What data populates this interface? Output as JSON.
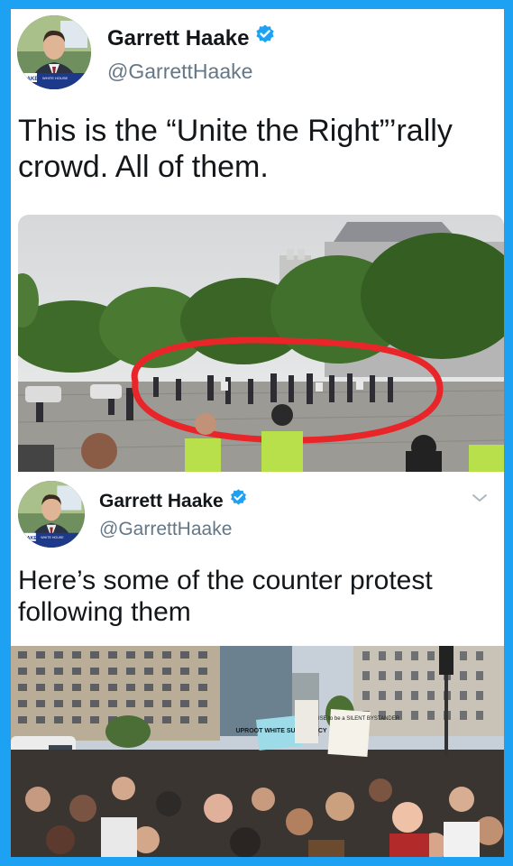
{
  "tweets": [
    {
      "author": {
        "name": "Garrett Haake",
        "handle": "@GarrettHaake",
        "verified": true,
        "avatar_badge": "HAAKE",
        "avatar_badge_sub": "WHITE HOUSE"
      },
      "text": "This is the “Unite the Right”’rally crowd. All of them.",
      "media": {
        "description_icon": "photo-rally-crowd-circled"
      }
    },
    {
      "author": {
        "name": "Garrett Haake",
        "handle": "@GarrettHaake",
        "verified": true,
        "avatar_badge": "HAAKE",
        "avatar_badge_sub": "WHITE HOUSE"
      },
      "text": "Here’s some of the counter protest following them",
      "media": {
        "sign_1": "UPROOT WHITE SUPREMACY",
        "sign_2": "I REFUSE to be a SILENT BYSTANDER"
      }
    }
  ],
  "colors": {
    "background": "#1da1f2",
    "verified": "#1da1f2",
    "name": "#14171a",
    "handle": "#657786",
    "circle": "#e8262a"
  }
}
